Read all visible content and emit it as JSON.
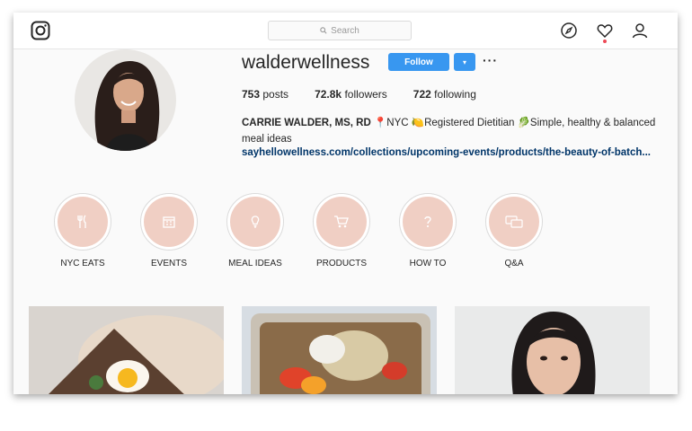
{
  "header": {
    "search_placeholder": "Search",
    "icons": [
      "instagram-logo-icon",
      "compass-icon",
      "heart-icon",
      "profile-icon"
    ]
  },
  "profile": {
    "username": "walderwellness",
    "follow_label": "Follow",
    "dropdown_glyph": "▾",
    "more_glyph": "···",
    "stats": {
      "posts_count": "753",
      "posts_label": "posts",
      "followers_count": "72.8k",
      "followers_label": "followers",
      "following_count": "722",
      "following_label": "following"
    },
    "bio_name": "CARRIE WALDER, MS, RD",
    "bio_text": "📍NYC 🍋Registered Dietitian 🥬Simple, healthy & balanced meal ideas",
    "link": "sayhellowellness.com/collections/upcoming-events/products/the-beauty-of-batch..."
  },
  "highlights": [
    {
      "label": "NYC EATS",
      "icon": "cutlery-icon"
    },
    {
      "label": "EVENTS",
      "icon": "calendar-icon"
    },
    {
      "label": "MEAL IDEAS",
      "icon": "lightbulb-icon"
    },
    {
      "label": "PRODUCTS",
      "icon": "cart-icon"
    },
    {
      "label": "HOW TO",
      "icon": "question-icon"
    },
    {
      "label": "Q&A",
      "icon": "chat-icon"
    }
  ],
  "colors": {
    "accent": "#3897f0",
    "highlight_fill": "#f0cfc4",
    "link": "#003569"
  }
}
